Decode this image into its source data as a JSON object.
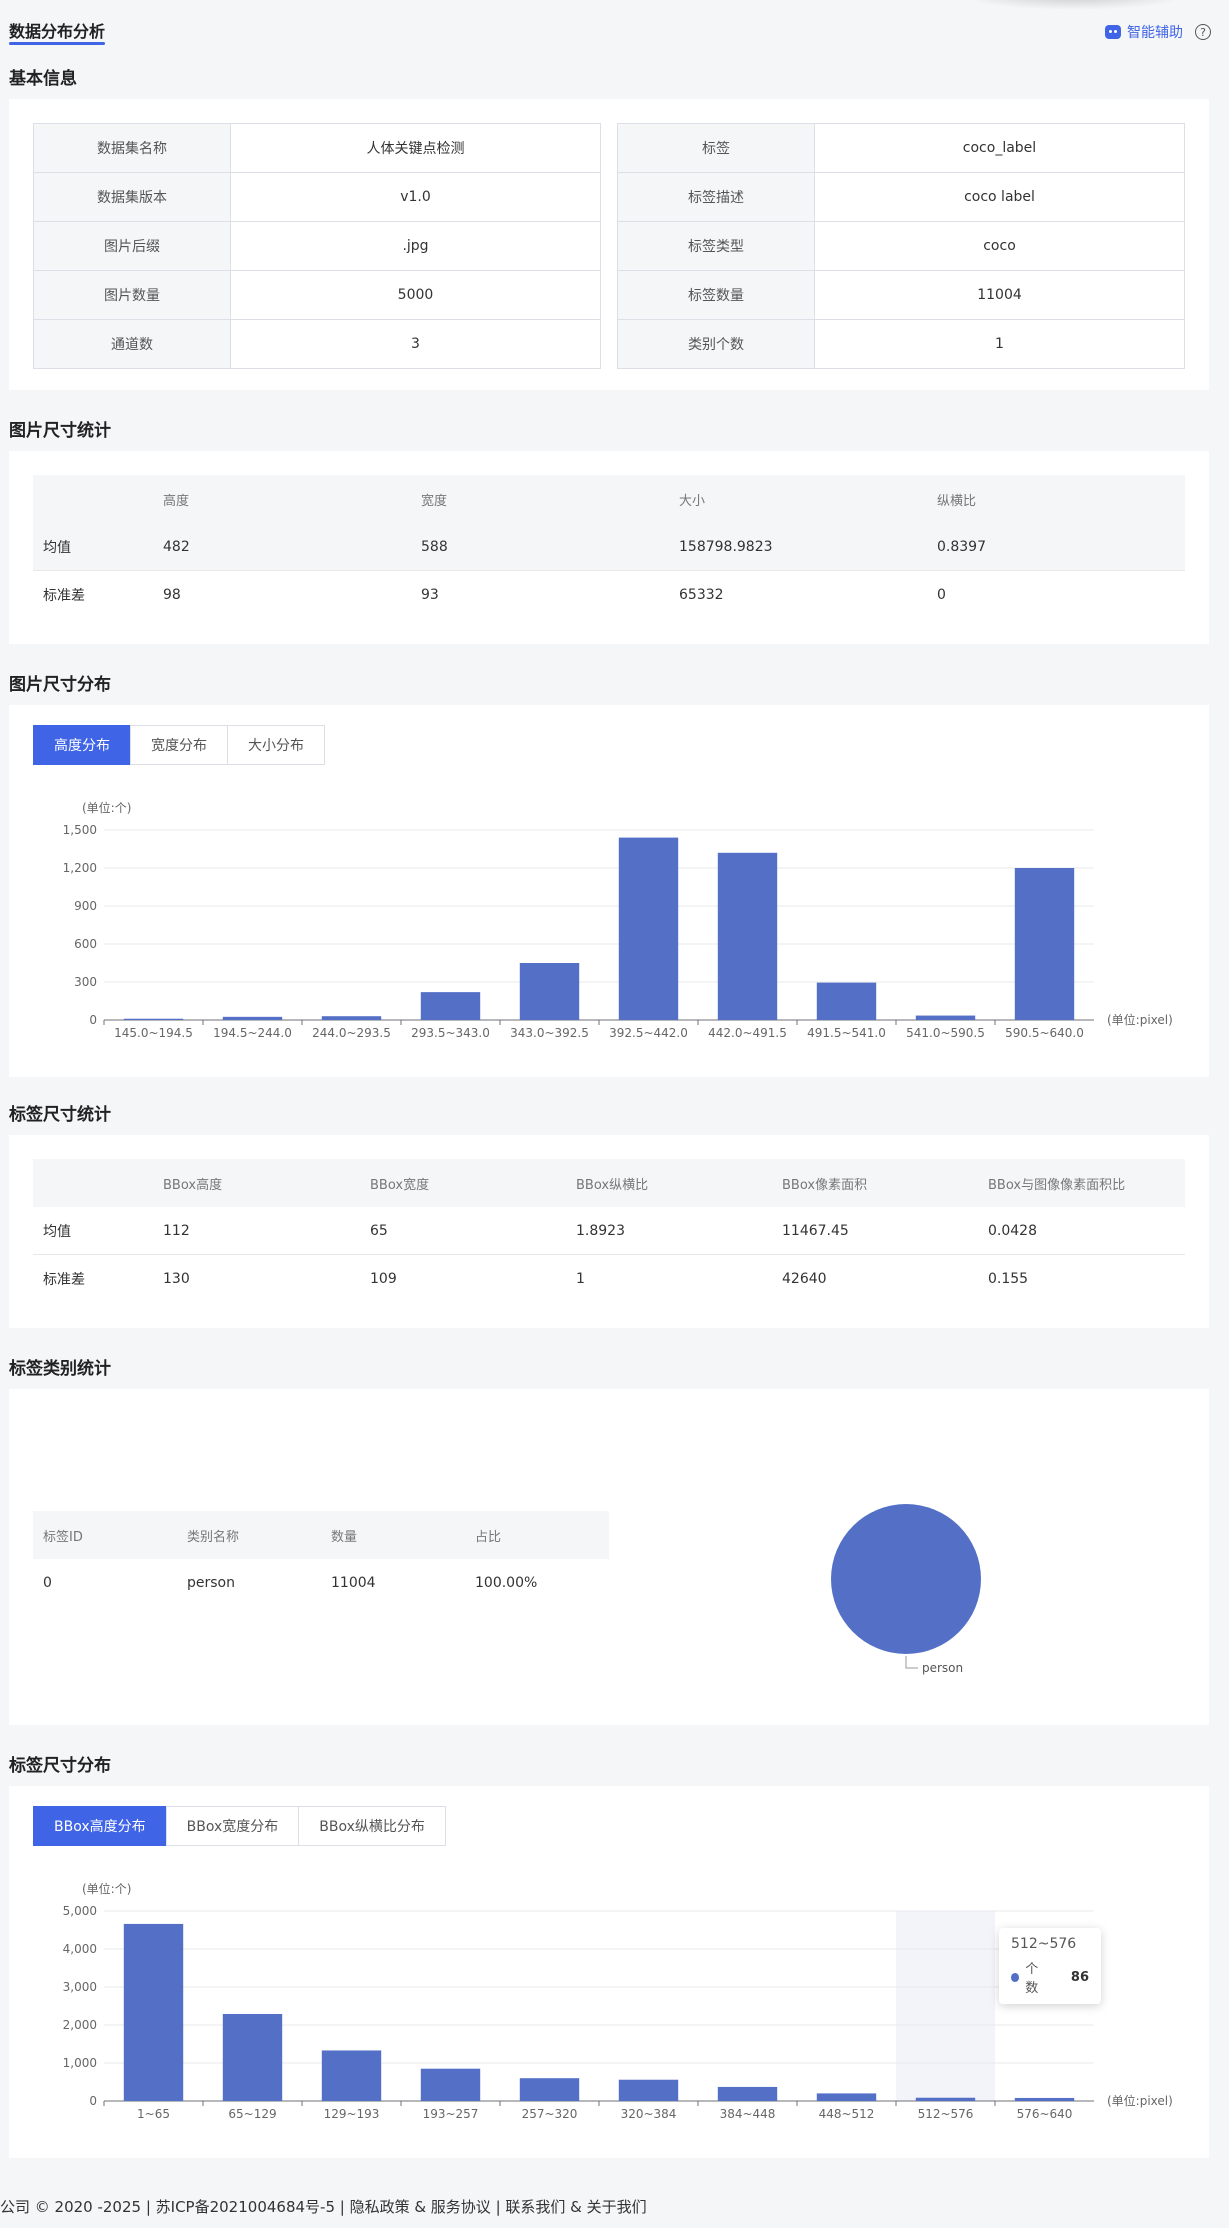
{
  "header": {
    "title": "数据分布分析",
    "assist_label": "智能辅助",
    "help_glyph": "?"
  },
  "basic_info": {
    "title": "基本信息",
    "left": [
      {
        "k": "数据集名称",
        "v": "人体关键点检测"
      },
      {
        "k": "数据集版本",
        "v": "v1.0"
      },
      {
        "k": "图片后缀",
        "v": ".jpg"
      },
      {
        "k": "图片数量",
        "v": "5000"
      },
      {
        "k": "通道数",
        "v": "3"
      }
    ],
    "right": [
      {
        "k": "标签",
        "v": "coco_label"
      },
      {
        "k": "标签描述",
        "v": "coco label"
      },
      {
        "k": "标签类型",
        "v": "coco"
      },
      {
        "k": "标签数量",
        "v": "11004"
      },
      {
        "k": "类别个数",
        "v": "1"
      }
    ]
  },
  "image_size_stats": {
    "title": "图片尺寸统计",
    "headers": [
      "",
      "高度",
      "宽度",
      "大小",
      "纵横比"
    ],
    "rows": [
      [
        "均值",
        "482",
        "588",
        "158798.9823",
        "0.8397"
      ],
      [
        "标准差",
        "98",
        "93",
        "65332",
        "0"
      ]
    ]
  },
  "image_size_dist": {
    "title": "图片尺寸分布",
    "tabs": [
      "高度分布",
      "宽度分布",
      "大小分布"
    ],
    "active_tab": 0,
    "unit_y": "(单位:个)",
    "unit_x": "(单位:pixel)"
  },
  "label_size_stats": {
    "title": "标签尺寸统计",
    "headers": [
      "",
      "BBox高度",
      "BBox宽度",
      "BBox纵横比",
      "BBox像素面积",
      "BBox与图像像素面积比"
    ],
    "rows": [
      [
        "均值",
        "112",
        "65",
        "1.8923",
        "11467.45",
        "0.0428"
      ],
      [
        "标准差",
        "130",
        "109",
        "1",
        "42640",
        "0.155"
      ]
    ]
  },
  "label_class_stats": {
    "title": "标签类别统计",
    "headers": [
      "标签ID",
      "类别名称",
      "数量",
      "占比"
    ],
    "rows": [
      [
        "0",
        "person",
        "11004",
        "100.00%"
      ]
    ],
    "pie_label": "person"
  },
  "label_size_dist": {
    "title": "标签尺寸分布",
    "tabs": [
      "BBox高度分布",
      "BBox宽度分布",
      "BBox纵横比分布"
    ],
    "active_tab": 0,
    "unit_y": "(单位:个)",
    "unit_x": "(单位:pixel)",
    "tooltip": {
      "title": "512~576",
      "series": "个数",
      "value": "86"
    }
  },
  "footer": {
    "text": "公司 © 2020 -2025 | 苏ICP备2021004684号-5 | 隐私政策 & 服务协议 | 联系我们  &  关于我们"
  },
  "colors": {
    "accent": "#3f64e6",
    "bar": "#5470c6"
  },
  "chart_data": [
    {
      "type": "bar",
      "categories": [
        "145.0~194.5",
        "194.5~244.0",
        "244.0~293.5",
        "293.5~343.0",
        "343.0~392.5",
        "392.5~442.0",
        "442.0~491.5",
        "491.5~541.0",
        "541.0~590.5",
        "590.5~640.0"
      ],
      "values": [
        10,
        25,
        30,
        220,
        450,
        1440,
        1320,
        295,
        35,
        1200
      ],
      "yticks": [
        "0",
        "300",
        "600",
        "900",
        "1,200",
        "1,500"
      ],
      "ylim": [
        0,
        1500
      ],
      "xlabel": "(单位:pixel)",
      "ylabel": "(单位:个)",
      "grid": true
    },
    {
      "type": "bar",
      "categories": [
        "1~65",
        "65~129",
        "129~193",
        "193~257",
        "257~320",
        "320~384",
        "384~448",
        "448~512",
        "512~576",
        "576~640"
      ],
      "values": [
        4660,
        2290,
        1330,
        850,
        600,
        560,
        370,
        200,
        86,
        80
      ],
      "yticks": [
        "0",
        "1,000",
        "2,000",
        "3,000",
        "4,000",
        "5,000"
      ],
      "ylim": [
        0,
        5000
      ],
      "xlabel": "(单位:pixel)",
      "ylabel": "(单位:个)",
      "highlight_index": 8,
      "grid": true
    },
    {
      "type": "pie",
      "labels": [
        "person"
      ],
      "values": [
        100
      ]
    }
  ]
}
